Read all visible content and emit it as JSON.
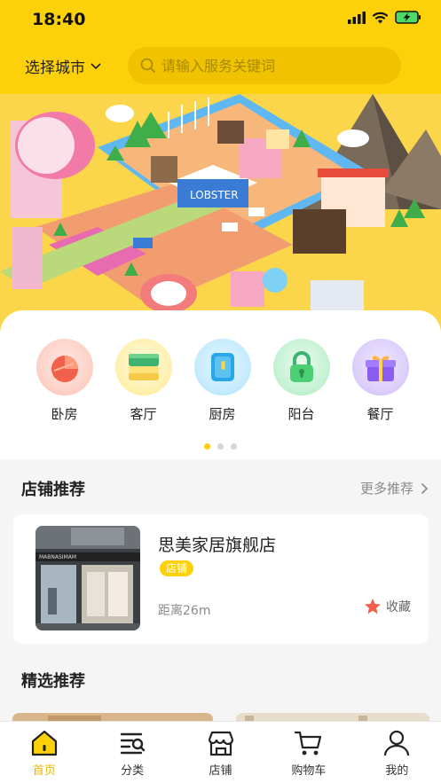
{
  "status_bar": {
    "time": "18:40"
  },
  "header": {
    "city_label": "选择城市",
    "search_placeholder": "请输入服务关键词"
  },
  "categories": [
    {
      "label": "卧房",
      "icon": "pie-chart-icon",
      "color": "#f0604a"
    },
    {
      "label": "客厅",
      "icon": "layers-icon",
      "color": "#3cb371"
    },
    {
      "label": "厨房",
      "icon": "door-icon",
      "color": "#2aa7e8"
    },
    {
      "label": "阳台",
      "icon": "lock-icon",
      "color": "#4ccf73"
    },
    {
      "label": "餐厅",
      "icon": "gift-icon",
      "color": "#8a5cf0"
    }
  ],
  "store_section": {
    "title": "店铺推荐",
    "more_label": "更多推荐",
    "store": {
      "name": "思美家居旗舰店",
      "tag": "店铺",
      "distance": "距离26m",
      "favorite_label": "收藏"
    }
  },
  "featured_section": {
    "title": "精选推荐"
  },
  "tabs": [
    {
      "label": "首页",
      "icon": "home-icon",
      "active": true
    },
    {
      "label": "分类",
      "icon": "category-list-icon",
      "active": false
    },
    {
      "label": "店铺",
      "icon": "store-icon",
      "active": false
    },
    {
      "label": "购物车",
      "icon": "cart-icon",
      "active": false
    },
    {
      "label": "我的",
      "icon": "user-icon",
      "active": false
    }
  ],
  "colors": {
    "accent": "#fdd10a",
    "favorite": "#f0604a"
  }
}
